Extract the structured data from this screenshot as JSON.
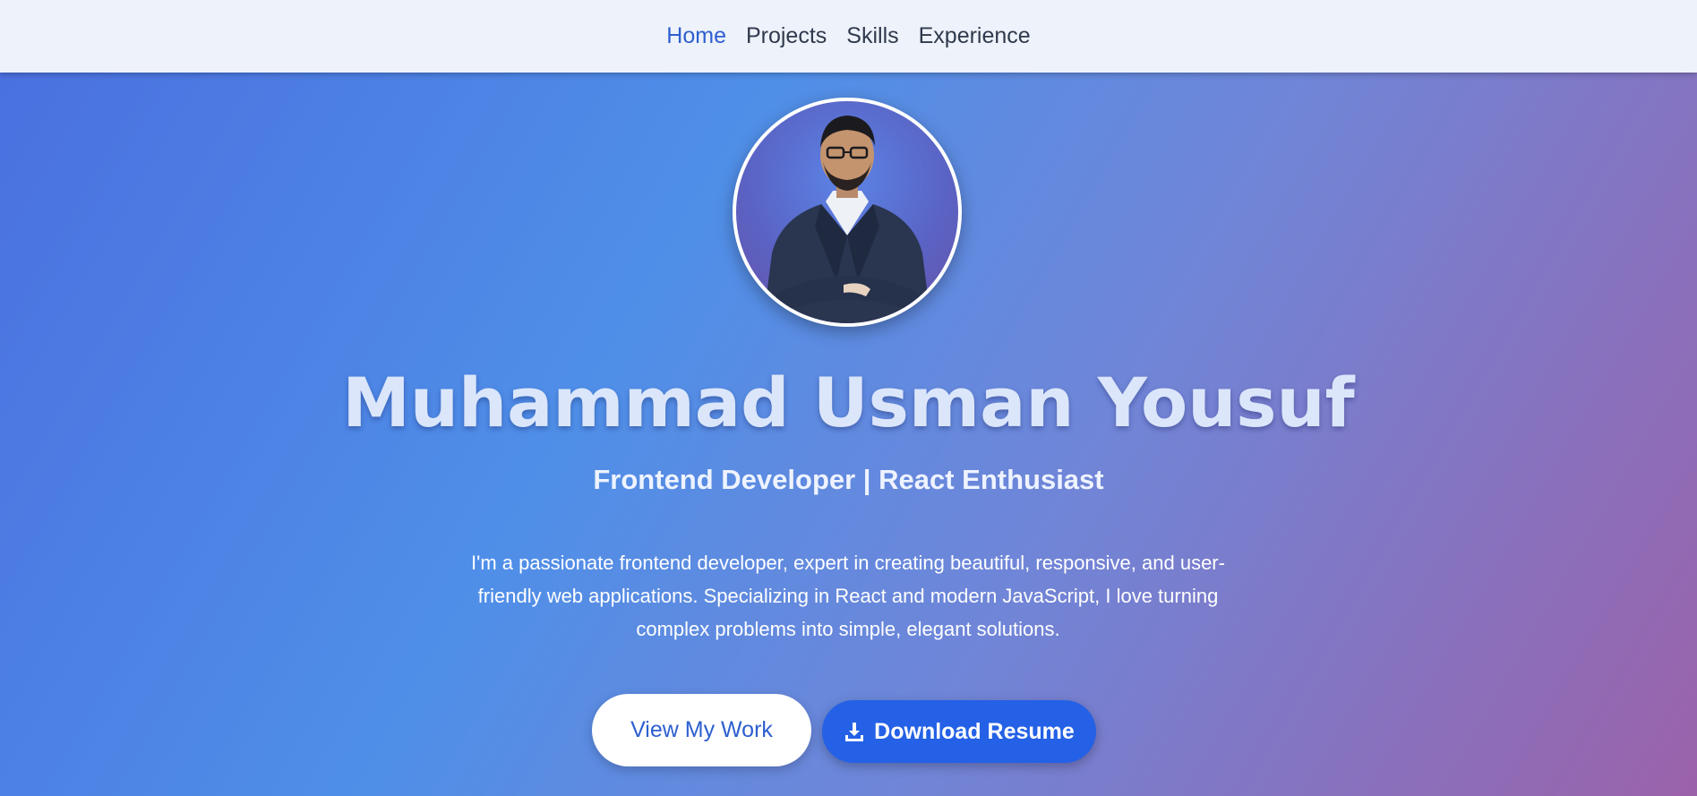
{
  "nav": {
    "items": [
      {
        "label": "Home",
        "active": true
      },
      {
        "label": "Projects",
        "active": false
      },
      {
        "label": "Skills",
        "active": false
      },
      {
        "label": "Experience",
        "active": false
      }
    ]
  },
  "hero": {
    "name": "Muhammad Usman Yousuf",
    "tagline": "Frontend Developer | React Enthusiast",
    "bio": "I'm a passionate frontend developer, expert in creating beautiful, responsive, and user-friendly web applications. Specializing in React and modern JavaScript, I love turning complex problems into simple, elegant solutions.",
    "view_work_label": "View My Work",
    "download_resume_label": "Download Resume",
    "download_icon": "download-icon"
  },
  "colors": {
    "accent": "#2461e6",
    "nav_active": "#2d5fcf",
    "nav_bg": "#eef2fa",
    "gradient_start": "#4a6fdf",
    "gradient_end": "#9b62aa"
  }
}
